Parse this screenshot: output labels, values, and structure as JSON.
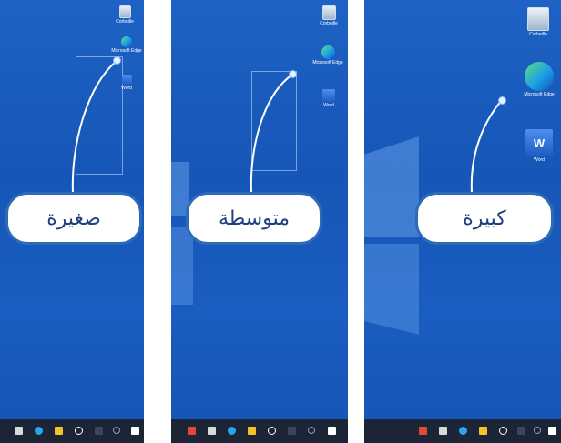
{
  "panels": [
    {
      "size_label": "صغيرة",
      "icons": [
        {
          "icon": "recycle-bin-icon",
          "label": "Corbeille"
        },
        {
          "icon": "edge-icon",
          "label": "Microsoft Edge"
        },
        {
          "icon": "word-icon",
          "label": "Word"
        }
      ]
    },
    {
      "size_label": "متوسطة",
      "icons": [
        {
          "icon": "recycle-bin-icon",
          "label": "Corbeille"
        },
        {
          "icon": "edge-icon",
          "label": "Microsoft Edge"
        },
        {
          "icon": "word-icon",
          "label": "Word"
        }
      ]
    },
    {
      "size_label": "كبيرة",
      "icons": [
        {
          "icon": "recycle-bin-icon",
          "label": "Corbeille"
        },
        {
          "icon": "edge-icon",
          "label": "Microsoft Edge"
        },
        {
          "icon": "word-icon",
          "label": "Word"
        }
      ]
    }
  ],
  "taskbar_icons": [
    "store-icon",
    "edge-icon",
    "file-explorer-icon",
    "cortana-icon",
    "task-view-icon",
    "search-icon",
    "start-icon"
  ],
  "colors": {
    "desktop": "#1a5cbf",
    "taskbar": "#1c2536",
    "callout_border": "#2d6ab8",
    "callout_text": "#1f3f7f"
  }
}
